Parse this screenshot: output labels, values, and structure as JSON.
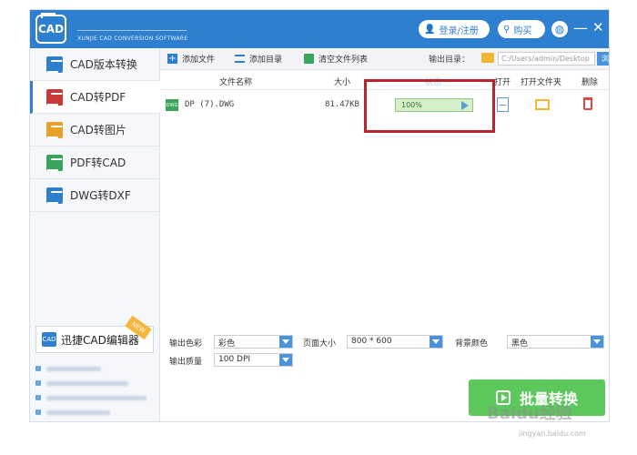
{
  "header": {
    "logo_text": "CAD",
    "subtitle": "XUNJIE CAD CONVERSION SOFTWARE",
    "login_label": "登录/注册",
    "buy_label": "购买",
    "brand_color": "#2f7fd1"
  },
  "sidebar": {
    "items": [
      {
        "label": "CAD版本转换",
        "icon": "version-convert-icon"
      },
      {
        "label": "CAD转PDF",
        "icon": "cad-pdf-icon",
        "active": true
      },
      {
        "label": "CAD转图片",
        "icon": "cad-image-icon"
      },
      {
        "label": "PDF转CAD",
        "icon": "pdf-cad-icon"
      },
      {
        "label": "DWG转DXF",
        "icon": "dwg-dxf-icon"
      }
    ],
    "editor_label": "迅捷CAD编辑器",
    "new_tag": "NEW"
  },
  "toolbar": {
    "add_file": "添加文件",
    "add_dir": "添加目录",
    "clear_list": "清空文件列表",
    "output_dir_label": "输出目录：",
    "output_path": "C:/Users/admin/Desktop",
    "browse": "浏览"
  },
  "table": {
    "headers": {
      "name": "文件名称",
      "size": "大小",
      "status": "状态",
      "open": "打开",
      "open_folder": "打开文件夹",
      "delete": "删除"
    },
    "rows": [
      {
        "name": "DP (7).DWG",
        "size": "81.47KB",
        "progress_text": "100%",
        "progress": 1.0
      }
    ]
  },
  "options": {
    "color_label": "输出色彩",
    "color_value": "彩色",
    "page_label": "页面大小",
    "page_value": "800 * 600",
    "bg_label": "背景颜色",
    "bg_value": "黑色",
    "quality_label": "输出质量",
    "quality_value": "100 DPI",
    "convert_label": "批量转换"
  },
  "watermark": {
    "text": "Baidu经验",
    "url": "jingyan.baidu.com"
  },
  "colors": {
    "accent": "#2f7fd1",
    "progress": "#d5f0c8",
    "convert": "#5cc85c",
    "highlight": "#b8232d"
  }
}
